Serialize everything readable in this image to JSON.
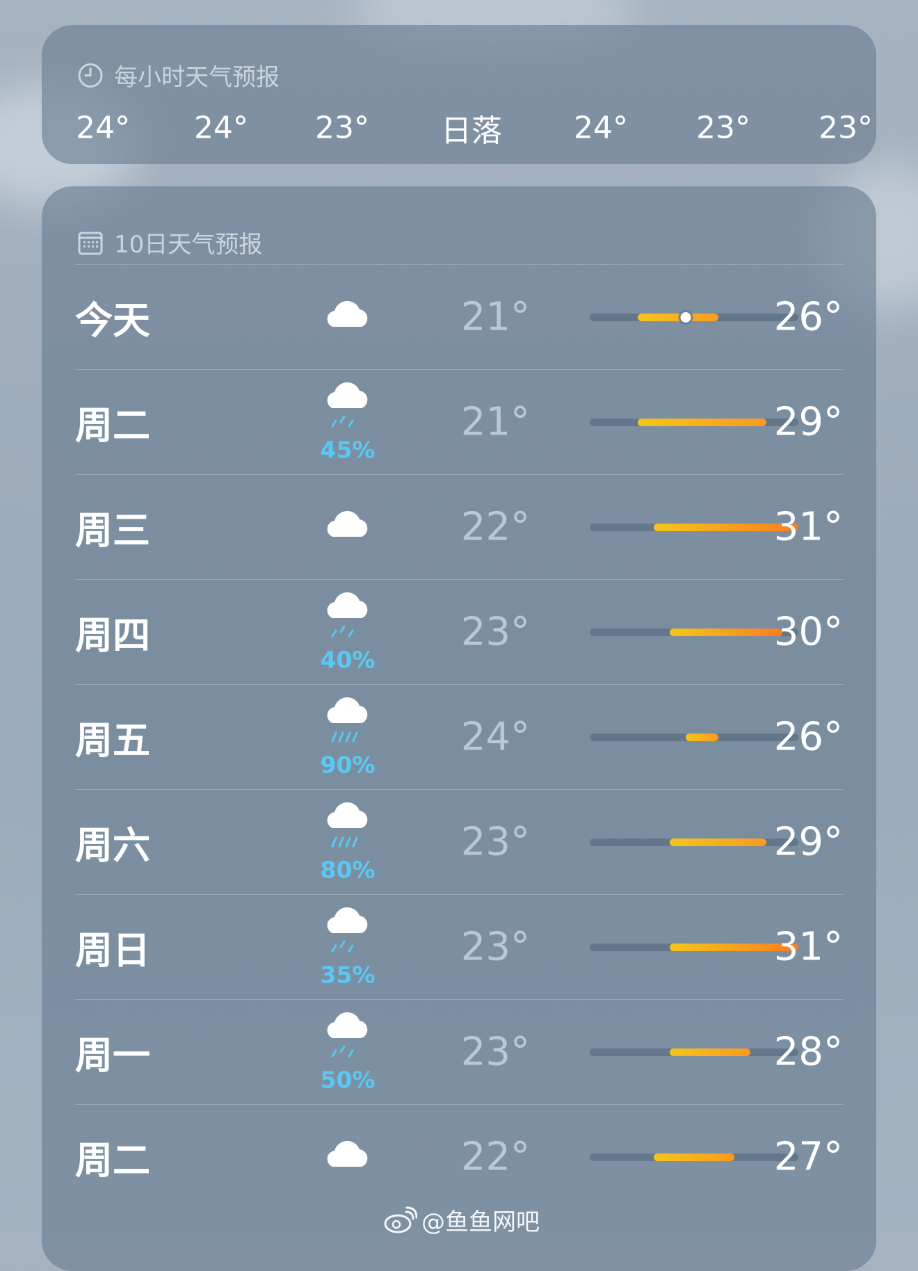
{
  "hourly": {
    "title": "每小时天气预报",
    "items": [
      "24°",
      "24°",
      "23°",
      "日落",
      "24°",
      "23°",
      "23°"
    ]
  },
  "daily": {
    "title": "10日天气预报",
    "days": [
      {
        "day": "今天",
        "icon": "cloud-icon",
        "precip": "",
        "low": "21°",
        "high": "26°",
        "low_val": 21,
        "high_val": 26,
        "current_val": 24
      },
      {
        "day": "周二",
        "icon": "cloud-rain-icon",
        "precip": "45%",
        "low": "21°",
        "high": "29°",
        "low_val": 21,
        "high_val": 29
      },
      {
        "day": "周三",
        "icon": "cloud-icon",
        "precip": "",
        "low": "22°",
        "high": "31°",
        "low_val": 22,
        "high_val": 31
      },
      {
        "day": "周四",
        "icon": "cloud-rain-icon",
        "precip": "40%",
        "low": "23°",
        "high": "30°",
        "low_val": 23,
        "high_val": 30
      },
      {
        "day": "周五",
        "icon": "cloud-heavy-rain-icon",
        "precip": "90%",
        "low": "24°",
        "high": "26°",
        "low_val": 24,
        "high_val": 26
      },
      {
        "day": "周六",
        "icon": "cloud-heavy-rain-icon",
        "precip": "80%",
        "low": "23°",
        "high": "29°",
        "low_val": 23,
        "high_val": 29
      },
      {
        "day": "周日",
        "icon": "cloud-rain-icon",
        "precip": "35%",
        "low": "23°",
        "high": "31°",
        "low_val": 23,
        "high_val": 31
      },
      {
        "day": "周一",
        "icon": "cloud-rain-icon",
        "precip": "50%",
        "low": "23°",
        "high": "28°",
        "low_val": 23,
        "high_val": 28
      },
      {
        "day": "周二",
        "icon": "cloud-icon",
        "precip": "",
        "low": "22°",
        "high": "27°",
        "low_val": 22,
        "high_val": 27
      }
    ],
    "range_min": 18,
    "range_max": 31
  },
  "watermark": "@鱼鱼网吧",
  "colors": {
    "bar_cool": "#f5c518",
    "bar_warm": "#fb7d22",
    "precip": "#5ac8f5"
  }
}
